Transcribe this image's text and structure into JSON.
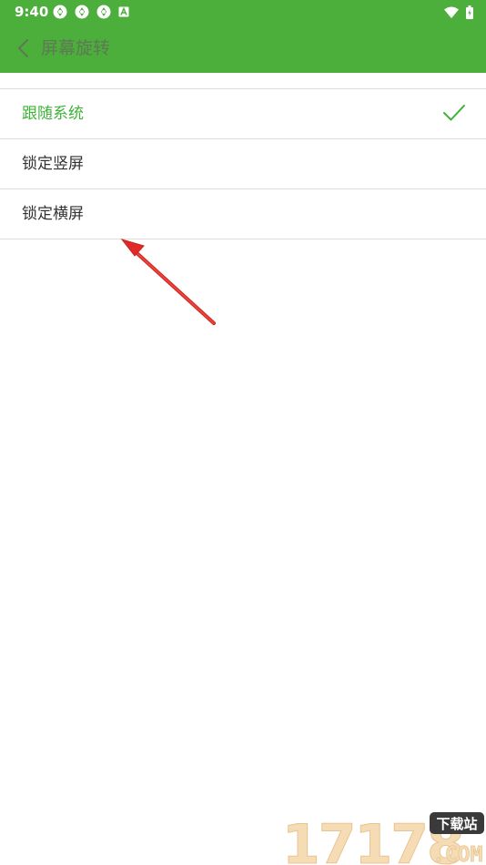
{
  "status_bar": {
    "time": "9:40",
    "notification_icons": [
      "sync-icon",
      "sync-icon",
      "sync-icon",
      "a-badge-icon"
    ],
    "system_icons": [
      "wifi-icon",
      "battery-icon"
    ]
  },
  "app_bar": {
    "title": "屏幕旋转",
    "back_icon": "chevron-left-icon",
    "background_color": "#4caf3b"
  },
  "options": [
    {
      "label": "跟随系统",
      "selected": true
    },
    {
      "label": "锁定竖屏",
      "selected": false
    },
    {
      "label": "锁定横屏",
      "selected": false
    }
  ],
  "colors": {
    "accent": "#3fb23a",
    "divider": "#dcdcdc",
    "annotation_arrow": "#e02a2a"
  },
  "watermark": {
    "number": "17178",
    "badge": "下载站",
    "suffix": ".COM"
  }
}
